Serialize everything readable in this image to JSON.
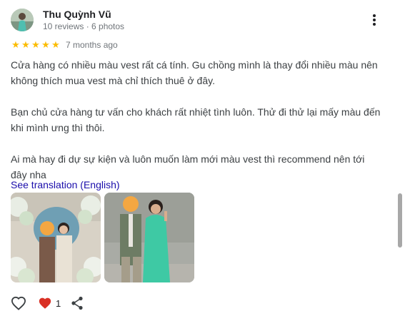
{
  "reviewer": {
    "name": "Thu Quỳnh Vũ",
    "meta": "10 reviews · 6 photos"
  },
  "rating": {
    "stars": 5,
    "star_glyph": "★",
    "star_color": "#fbbc04",
    "time": "7 months ago"
  },
  "review_text": {
    "p1": "Cửa hàng có nhiều màu vest rất cá tính. Gu chồng mình là thay đổi nhiều màu nên không thích mua vest mà chỉ thích thuê ở đây.",
    "p2": "Bạn chủ cửa hàng tư vấn cho khách rất nhiệt tình luôn. Thử đi thử lại mấy màu đến khi mình ưng thì thôi.",
    "p3": "Ai mà hay đi dự sự kiện và luôn muốn làm mới màu vest thì recommend nên tới đây nha"
  },
  "translate_link": "See translation (English)",
  "photos": [
    {
      "icon": "wedding-couple-photo"
    },
    {
      "icon": "couple-outdoor-photo"
    }
  ],
  "actions": {
    "like_icon": "heart-outline-icon",
    "liked_icon": "heart-filled-icon",
    "like_count": "1",
    "share_icon": "share-icon",
    "heart_color": "#d93025"
  },
  "more_menu_icon": "more-vert-icon"
}
